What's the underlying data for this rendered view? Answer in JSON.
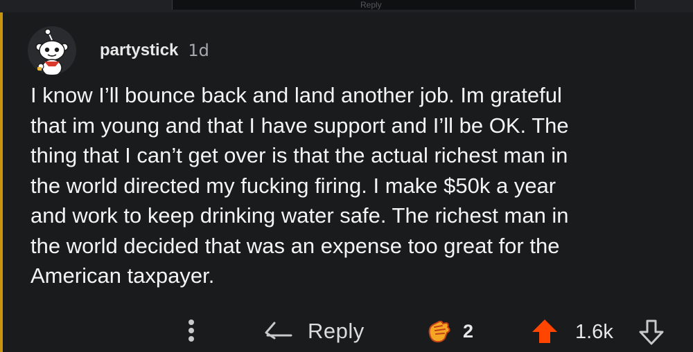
{
  "previous_comment": {
    "faint_text": "Reply"
  },
  "comment": {
    "username": "partystick",
    "age": "1d",
    "body": "I know I’ll bounce back and land another job. Im grateful\nthat im young and that I have support and I’ll be OK. The\nthing that I can’t get over is that the actual richest man in\nthe world directed my fucking firing. I make $50k a year\nand work to keep drinking water safe. The richest man in\nthe world decided that was an expense too great for the\nAmerican taxpayer.",
    "avatar_icon": "snoo-avatar-icon"
  },
  "actions": {
    "more_icon": "more-options-icon",
    "reply_icon": "reply-arrow-icon",
    "reply_label": "Reply",
    "award_icon": "award-hand-icon",
    "award_count": "2",
    "upvote_icon": "upvote-arrow-icon",
    "score": "1.6k",
    "downvote_icon": "downvote-arrow-icon"
  },
  "colors": {
    "background": "#1a1b1d",
    "thread_line": "#c7950e",
    "upvote_active": "#ff4500",
    "award": "#f5a623"
  }
}
